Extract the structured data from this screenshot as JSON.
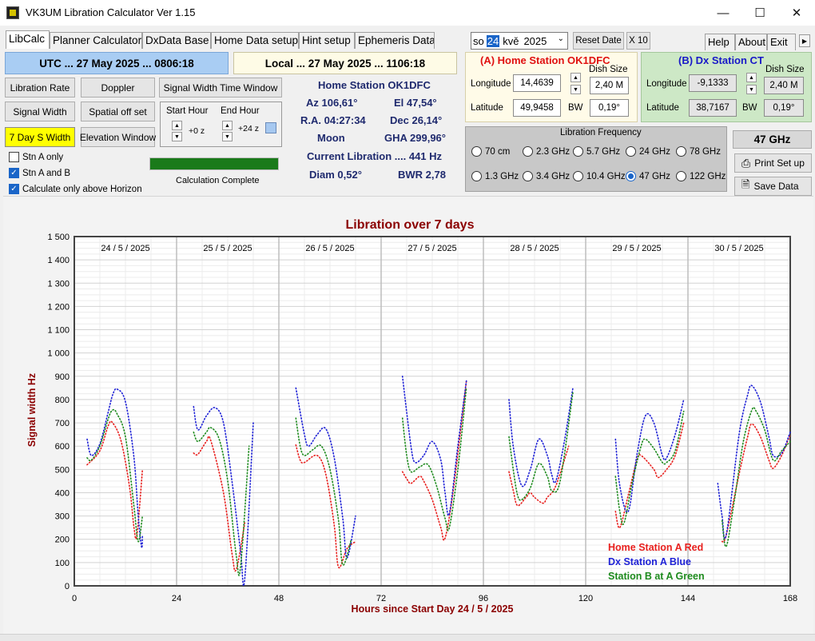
{
  "window": {
    "title": "VK3UM Libration Calculator Ver 1.15"
  },
  "tabs": [
    "LibCalc",
    "Planner Calculator",
    "DxData Base",
    "Home Data setup",
    "Hint setup",
    "Ephemeris Data"
  ],
  "date_picker": {
    "day_name": "so",
    "day": "24",
    "month": "kvě",
    "year": "2025"
  },
  "top_buttons": {
    "reset_date": "Reset Date",
    "x10": "X 10",
    "help": "Help",
    "about": "About",
    "exit": "Exit"
  },
  "time": {
    "utc": "UTC ... 27 May 2025 ... 0806:18",
    "local": "Local ... 27 May 2025 ... 1106:18"
  },
  "buttons": {
    "libration_rate": "Libration Rate",
    "doppler": "Doppler",
    "signal_width_time_window": "Signal Width Time Window",
    "signal_width": "Signal Width",
    "spatial_offset": "Spatial off set",
    "seven_day": "7 Day S Width",
    "elevation_window": "Elevation Window"
  },
  "hour_window": {
    "start_label": "Start Hour",
    "end_label": "End  Hour",
    "start_value": "+0 z",
    "end_value": "+24 z"
  },
  "checkboxes": [
    {
      "label": "Stn A only",
      "checked": false
    },
    {
      "label": "Stn A and B",
      "checked": true
    },
    {
      "label": "Calculate only above Horizon",
      "checked": true
    }
  ],
  "progress": {
    "value": 1.0,
    "status": "Calculation Complete",
    "color": "#1a7a1a"
  },
  "home_info": {
    "station": "Home  Station   OK1DFC",
    "az": "Az 106,61°",
    "el": "El 47,54°",
    "ra": "R.A. 04:27:34",
    "dec": "Dec 26,14°",
    "moon": "Moon",
    "gha": "GHA 299,96°",
    "current_libration": "Current Libration .... 441 Hz",
    "diam": "Diam 0,52°",
    "bwr": "BWR 2,78"
  },
  "station_a": {
    "title": "(A)   Home Station   OK1DFC",
    "longitude_label": "Longitude",
    "longitude": "14,4639",
    "latitude_label": "Latitude",
    "latitude": "49,9458",
    "dish_label": "Dish Size",
    "dish": "2,40 M",
    "bw_label": "BW",
    "bw": "0,19°"
  },
  "station_b": {
    "title": "(B)    Dx Station CT",
    "longitude_label": "Longitude",
    "longitude": "-9,1333",
    "latitude_label": "Latitude",
    "latitude": "38,7167",
    "dish_label": "Dish Size",
    "dish": "2,40 M",
    "bw_label": "BW",
    "bw": "0,19°"
  },
  "frequency": {
    "title": "Libration Frequency",
    "selected_display": "47 GHz",
    "options": [
      "70 cm",
      "2.3 GHz",
      "5.7 GHz",
      "24 GHz",
      "78 GHz",
      "1.3 GHz",
      "3.4 GHz",
      "10.4 GHz",
      "47 GHz",
      "122 GHz"
    ],
    "selected_index": 8
  },
  "actions": {
    "print_setup": "Print Set up",
    "save_data": "Save Data"
  },
  "colors": {
    "home": "#e8201e",
    "dx": "#1f22d6",
    "green": "#1e8b1e",
    "title": "#8b0000"
  },
  "chart_data": {
    "type": "scatter",
    "title": "Libration over 7 days",
    "xlabel": "Hours since Start Day 24 / 5 / 2025",
    "ylabel": "Signal width Hz",
    "xlim": [
      0,
      168
    ],
    "ylim": [
      0,
      1500
    ],
    "x_ticks": [
      "0",
      "24",
      "48",
      "72",
      "96",
      "120",
      "144",
      "168"
    ],
    "y_ticks": [
      "0",
      "100",
      "200",
      "300",
      "400",
      "500",
      "600",
      "700",
      "800",
      "900",
      "1 000",
      "1 100",
      "1 200",
      "1 300",
      "1 400",
      "1 500"
    ],
    "day_labels": [
      "24 / 5 / 2025",
      "25 / 5 / 2025",
      "26 / 5 / 2025",
      "27 / 5 / 2025",
      "28 / 5 / 2025",
      "29 / 5 / 2025",
      "30 / 5 / 2025"
    ],
    "legend": [
      {
        "label": "Home  Station A Red",
        "color": "#e8201e"
      },
      {
        "label": "Dx     Station A Blue",
        "color": "#1f22d6"
      },
      {
        "label": "Station B at A Green",
        "color": "#1e8b1e"
      }
    ],
    "legend_position": "bottom-right",
    "grid": true,
    "series": [
      {
        "color": "#e8201e",
        "segments": [
          [
            [
              3,
              520
            ],
            [
              6,
              580
            ],
            [
              8,
              690
            ],
            [
              9,
              700
            ],
            [
              11,
              620
            ],
            [
              13,
              420
            ],
            [
              14,
              250
            ],
            [
              14.7,
              220
            ],
            [
              16,
              500
            ]
          ],
          [
            [
              28,
              570
            ],
            [
              29,
              565
            ],
            [
              31,
              620
            ],
            [
              32,
              625
            ],
            [
              35,
              400
            ],
            [
              37,
              140
            ],
            [
              38,
              70
            ],
            [
              40,
              270
            ]
          ],
          [
            [
              52,
              605
            ],
            [
              53,
              540
            ],
            [
              54,
              530
            ],
            [
              57,
              560
            ],
            [
              59,
              480
            ],
            [
              61,
              260
            ],
            [
              62,
              80
            ],
            [
              64,
              160
            ],
            [
              66,
              190
            ]
          ],
          [
            [
              77,
              490
            ],
            [
              78,
              460
            ],
            [
              79,
              440
            ],
            [
              81,
              470
            ],
            [
              82,
              450
            ],
            [
              84,
              370
            ],
            [
              86,
              250
            ],
            [
              87,
              205
            ],
            [
              89,
              420
            ],
            [
              92,
              880
            ]
          ],
          [
            [
              102,
              490
            ],
            [
              103,
              410
            ],
            [
              104,
              345
            ],
            [
              106,
              380
            ],
            [
              107,
              400
            ],
            [
              108,
              380
            ],
            [
              110,
              355
            ],
            [
              111,
              380
            ],
            [
              113,
              430
            ],
            [
              116,
              600
            ]
          ],
          [
            [
              127,
              320
            ],
            [
              128,
              250
            ],
            [
              130,
              390
            ],
            [
              132,
              540
            ],
            [
              133,
              560
            ],
            [
              136,
              500
            ],
            [
              137,
              465
            ],
            [
              139,
              500
            ],
            [
              141,
              560
            ],
            [
              143,
              700
            ]
          ],
          [
            [
              152,
              190
            ],
            [
              153,
              220
            ],
            [
              156,
              480
            ],
            [
              158,
              640
            ],
            [
              159,
              695
            ],
            [
              161,
              640
            ],
            [
              163,
              540
            ],
            [
              164,
              505
            ],
            [
              166,
              560
            ],
            [
              168,
              650
            ]
          ]
        ]
      },
      {
        "color": "#1f22d6",
        "segments": [
          [
            [
              3,
              630
            ],
            [
              4,
              560
            ],
            [
              6,
              610
            ],
            [
              8,
              750
            ],
            [
              9,
              820
            ],
            [
              10,
              845
            ],
            [
              12,
              790
            ],
            [
              14,
              550
            ],
            [
              15,
              300
            ],
            [
              15.8,
              165
            ],
            [
              16,
              220
            ]
          ],
          [
            [
              28,
              770
            ],
            [
              29,
              670
            ],
            [
              31,
              730
            ],
            [
              33,
              765
            ],
            [
              35,
              700
            ],
            [
              37,
              450
            ],
            [
              39,
              150
            ],
            [
              40,
              30
            ],
            [
              42,
              700
            ]
          ],
          [
            [
              52,
              850
            ],
            [
              54,
              650
            ],
            [
              55,
              600
            ],
            [
              57,
              650
            ],
            [
              59,
              675
            ],
            [
              61,
              550
            ],
            [
              63,
              290
            ],
            [
              64,
              120
            ],
            [
              66,
              300
            ]
          ],
          [
            [
              77,
              900
            ],
            [
              79,
              600
            ],
            [
              80,
              530
            ],
            [
              82,
              560
            ],
            [
              84,
              620
            ],
            [
              86,
              540
            ],
            [
              87,
              400
            ],
            [
              88,
              310
            ],
            [
              90,
              600
            ],
            [
              92,
              880
            ]
          ],
          [
            [
              102,
              800
            ],
            [
              103,
              600
            ],
            [
              105,
              430
            ],
            [
              107,
              500
            ],
            [
              109,
              630
            ],
            [
              111,
              560
            ],
            [
              112,
              480
            ],
            [
              113,
              450
            ],
            [
              115,
              620
            ],
            [
              117,
              850
            ]
          ],
          [
            [
              127,
              630
            ],
            [
              128,
              430
            ],
            [
              130,
              320
            ],
            [
              132,
              560
            ],
            [
              134,
              730
            ],
            [
              136,
              700
            ],
            [
              138,
              560
            ],
            [
              139,
              550
            ],
            [
              141,
              650
            ],
            [
              143,
              800
            ]
          ],
          [
            [
              151,
              440
            ],
            [
              152,
              300
            ],
            [
              153,
              220
            ],
            [
              156,
              650
            ],
            [
              158,
              820
            ],
            [
              159,
              860
            ],
            [
              161,
              790
            ],
            [
              163,
              640
            ],
            [
              164,
              560
            ],
            [
              166,
              570
            ],
            [
              168,
              660
            ]
          ]
        ]
      },
      {
        "color": "#1e8b1e",
        "segments": [
          [
            [
              3,
              550
            ],
            [
              4,
              540
            ],
            [
              6,
              600
            ],
            [
              8,
              720
            ],
            [
              9,
              755
            ],
            [
              10,
              740
            ],
            [
              12,
              640
            ],
            [
              14,
              340
            ],
            [
              15,
              190
            ],
            [
              16,
              300
            ]
          ],
          [
            [
              28,
              660
            ],
            [
              29,
              620
            ],
            [
              31,
              660
            ],
            [
              32,
              680
            ],
            [
              34,
              630
            ],
            [
              36,
              450
            ],
            [
              38,
              130
            ],
            [
              39,
              80
            ],
            [
              41,
              600
            ]
          ],
          [
            [
              52,
              720
            ],
            [
              53,
              600
            ],
            [
              54,
              560
            ],
            [
              56,
              585
            ],
            [
              58,
              600
            ],
            [
              60,
              500
            ],
            [
              62,
              280
            ],
            [
              63,
              90
            ],
            [
              65,
              200
            ]
          ],
          [
            [
              77,
              720
            ],
            [
              78,
              560
            ],
            [
              79,
              490
            ],
            [
              81,
              510
            ],
            [
              83,
              520
            ],
            [
              85,
              430
            ],
            [
              87,
              290
            ],
            [
              88,
              250
            ],
            [
              90,
              500
            ],
            [
              92,
              850
            ]
          ],
          [
            [
              102,
              640
            ],
            [
              103,
              500
            ],
            [
              104,
              390
            ],
            [
              105,
              370
            ],
            [
              107,
              420
            ],
            [
              109,
              525
            ],
            [
              111,
              470
            ],
            [
              112,
              410
            ],
            [
              114,
              450
            ],
            [
              117,
              830
            ]
          ],
          [
            [
              127,
              470
            ],
            [
              128,
              320
            ],
            [
              129,
              270
            ],
            [
              131,
              450
            ],
            [
              133,
              600
            ],
            [
              134,
              630
            ],
            [
              136,
              590
            ],
            [
              138,
              530
            ],
            [
              139,
              530
            ],
            [
              141,
              580
            ],
            [
              143,
              750
            ]
          ],
          [
            [
              152,
              280
            ],
            [
              153,
              170
            ],
            [
              155,
              380
            ],
            [
              157,
              620
            ],
            [
              159,
              755
            ],
            [
              160,
              750
            ],
            [
              162,
              670
            ],
            [
              164,
              540
            ],
            [
              166,
              580
            ],
            [
              168,
              620
            ]
          ]
        ]
      }
    ]
  }
}
